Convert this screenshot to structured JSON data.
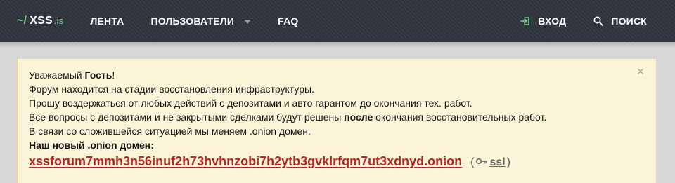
{
  "header": {
    "logo": {
      "prefix": "~/",
      "name": "XSS",
      "tld": ".is"
    },
    "nav": [
      {
        "label": "ЛЕНТА"
      },
      {
        "label": "ПОЛЬЗОВАТЕЛИ",
        "has_dropdown": true
      },
      {
        "label": "FAQ"
      }
    ],
    "actions": {
      "login_label": "ВХОД",
      "search_label": "ПОИСК"
    }
  },
  "notice": {
    "greeting_prefix": "Уважаемый ",
    "greeting_name": "Гость",
    "greeting_suffix": "!",
    "line1": "Форум находится на стадии восстановления инфраструктуры.",
    "line2": "Прошу воздержаться от любых действий с депозитами и авто гарантом до окончания тех. работ.",
    "line3_prefix": "Все вопросы с депозитами и не закрытыми сделками будут решены ",
    "line3_bold": "после",
    "line3_suffix": " окончания восстановительных работ.",
    "line4": "В связи со сложившейся ситуацией мы меняем .onion домен.",
    "new_domain_label": "Наш новый .onion домен:",
    "onion_domain": "xssforum7mmh3n56inuf2h73hvhnzobi7h2ytb3gvklrfqm7ut3xdnyd.onion",
    "ssl_open_paren": "(",
    "ssl_label": "ssl",
    "ssl_close_paren": ")",
    "close_symbol": "×"
  },
  "colors": {
    "header_bg": "#2b3038",
    "logo_accent": "#7bd58e",
    "notice_bg": "#fbf4d8",
    "notice_border": "#efd48e",
    "onion_link": "#b32525",
    "page_bg": "#d7d7d7"
  },
  "icons": {
    "login": "login-arrow-icon",
    "search": "search-icon",
    "dropdown": "chevron-down-icon",
    "key": "key-icon",
    "close": "close-icon"
  }
}
